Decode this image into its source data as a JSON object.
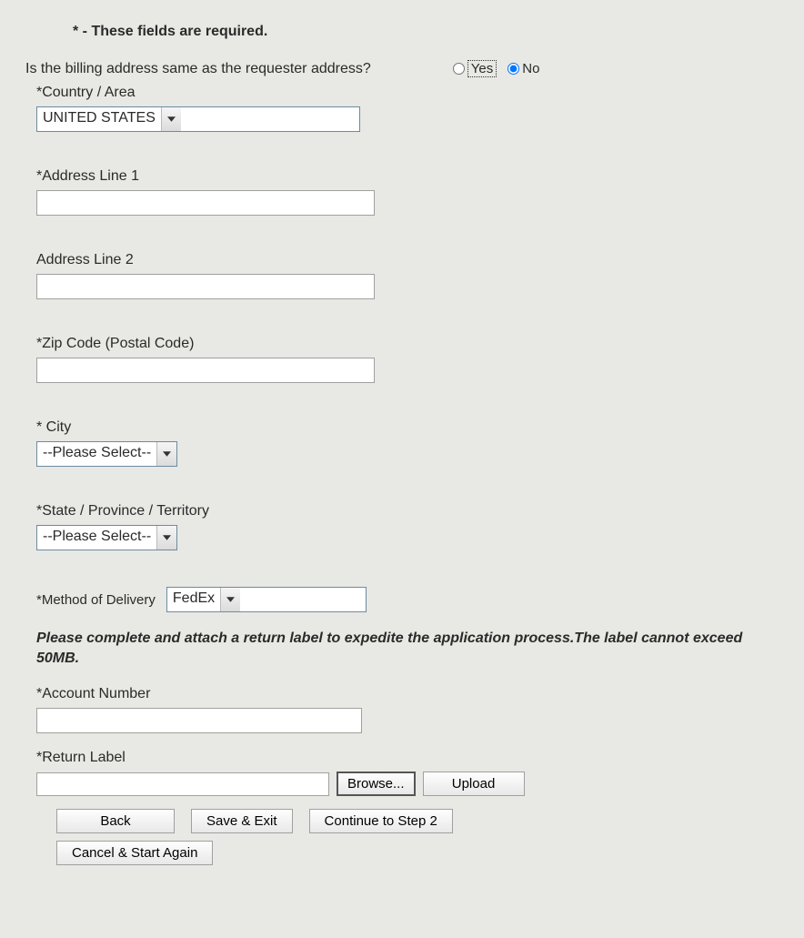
{
  "required_note": "* - These fields are required.",
  "question": {
    "text": "Is the billing address same as the requester address?",
    "yes_label": "Yes",
    "no_label": "No",
    "selected": "no"
  },
  "fields": {
    "country": {
      "label": "*Country / Area",
      "value": "UNITED STATES"
    },
    "address1": {
      "label": "*Address Line 1",
      "value": ""
    },
    "address2": {
      "label": "Address Line 2",
      "value": ""
    },
    "zip": {
      "label": "*Zip Code (Postal Code)",
      "value": ""
    },
    "city": {
      "label": "* City",
      "value": "--Please Select--"
    },
    "state": {
      "label": "*State / Province / Territory",
      "value": "--Please Select--"
    },
    "delivery": {
      "label": "*Method of Delivery",
      "value": "FedEx"
    },
    "account": {
      "label": "*Account Number",
      "value": ""
    },
    "return_label": {
      "label": "*Return Label",
      "value": ""
    }
  },
  "instruction": "Please complete and attach a return label to expedite the application process.The label cannot exceed 50MB.",
  "buttons": {
    "browse": "Browse...",
    "upload": "Upload",
    "back": "Back",
    "save_exit": "Save & Exit",
    "continue": "Continue to Step 2",
    "cancel": "Cancel & Start Again"
  }
}
